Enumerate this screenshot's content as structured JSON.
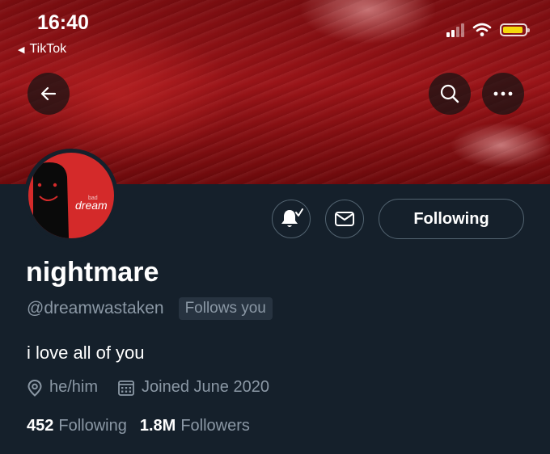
{
  "status_bar": {
    "time": "16:40",
    "back_app": "TikTok"
  },
  "nav": {
    "back": "back",
    "search": "search",
    "more": "more"
  },
  "avatar": {
    "text_small": "bad",
    "text_main": "dream"
  },
  "actions": {
    "following_label": "Following"
  },
  "profile": {
    "display_name": "nightmare",
    "handle": "@dreamwastaken",
    "follows_you": "Follows you",
    "bio": "i love all of you",
    "pronouns": "he/him",
    "joined": "Joined June 2020"
  },
  "stats": {
    "following_count": "452",
    "following_label": "Following",
    "followers_count": "1.8M",
    "followers_label": "Followers"
  },
  "colors": {
    "background": "#15202b",
    "banner": "#8a1014",
    "muted_text": "#8b98a5",
    "border": "#536471",
    "avatar_red": "#d42a2a",
    "battery": "#f5d90a"
  }
}
